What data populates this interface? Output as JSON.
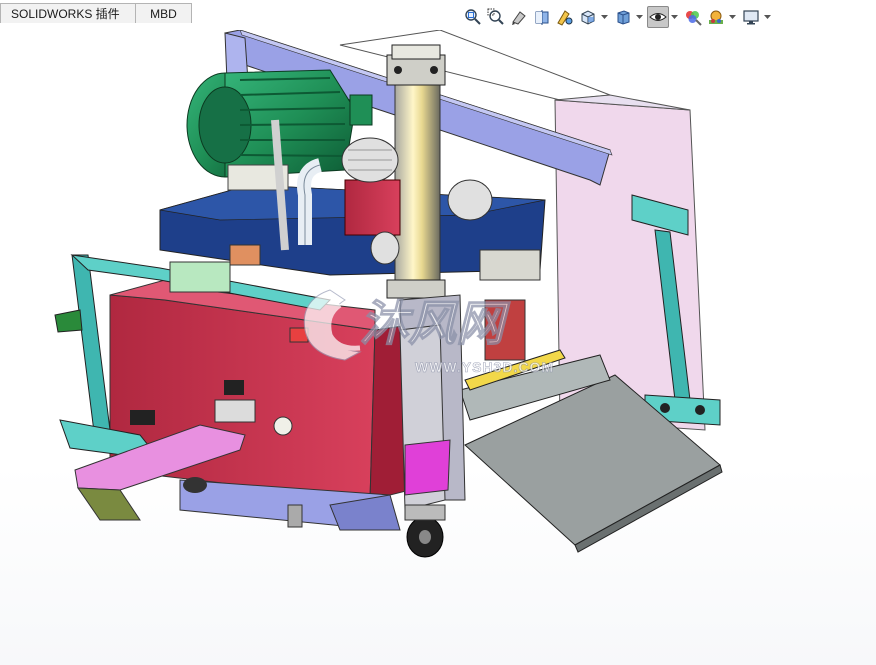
{
  "tabs": [
    {
      "label": "SOLIDWORKS 插件"
    },
    {
      "label": "MBD"
    }
  ],
  "toolbar": {
    "icons": [
      "zoom-to-fit-icon",
      "zoom-to-area-icon",
      "previous-view-icon",
      "section-view-icon",
      "dynamic-annotation-icon",
      "view-orientation-icon",
      "display-style-icon",
      "hide-show-items-icon",
      "edit-appearance-icon",
      "apply-scene-icon",
      "view-settings-icon"
    ]
  },
  "watermark": {
    "brand_cn": "沐风网",
    "site": "WWW.YSH3D.COM"
  },
  "colors": {
    "motor_green": "#1f8f56",
    "tank_blue": "#1e3f8a",
    "reservoir_red": "#c8304c",
    "frame_lavender": "#9aa1e6",
    "panel_pink": "#f0d8ec",
    "teal": "#3fb6b0",
    "chute_gray": "#9aa0a0",
    "magenta": "#e040d8"
  }
}
